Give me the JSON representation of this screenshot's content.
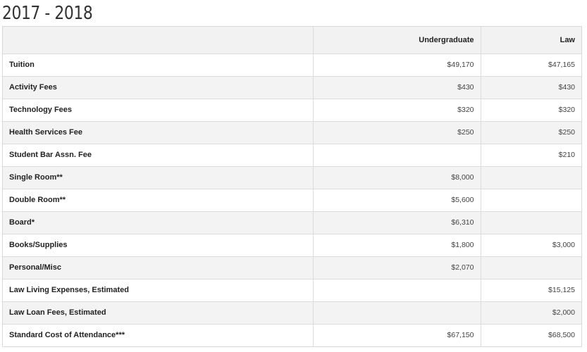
{
  "title": "2017 - 2018",
  "table": {
    "headers": [
      "",
      "Undergraduate",
      "Law"
    ],
    "rows": [
      {
        "label": "Tuition",
        "undergraduate": "$49,170",
        "law": "$47,165"
      },
      {
        "label": "Activity Fees",
        "undergraduate": "$430",
        "law": "$430"
      },
      {
        "label": "Technology Fees",
        "undergraduate": "$320",
        "law": "$320"
      },
      {
        "label": "Health Services Fee",
        "undergraduate": "$250",
        "law": "$250"
      },
      {
        "label": "Student Bar Assn. Fee",
        "undergraduate": "",
        "law": "$210"
      },
      {
        "label": "Single Room**",
        "undergraduate": "$8,000",
        "law": ""
      },
      {
        "label": "Double Room**",
        "undergraduate": "$5,600",
        "law": ""
      },
      {
        "label": "Board*",
        "undergraduate": "$6,310",
        "law": ""
      },
      {
        "label": "Books/Supplies",
        "undergraduate": "$1,800",
        "law": "$3,000"
      },
      {
        "label": "Personal/Misc",
        "undergraduate": "$2,070",
        "law": ""
      },
      {
        "label": "Law Living Expenses, Estimated",
        "undergraduate": "",
        "law": "$15,125"
      },
      {
        "label": "Law Loan Fees, Estimated",
        "undergraduate": "",
        "law": "$2,000"
      },
      {
        "label": "Standard Cost of Attendance***",
        "undergraduate": "$67,150",
        "law": "$68,500"
      }
    ]
  }
}
